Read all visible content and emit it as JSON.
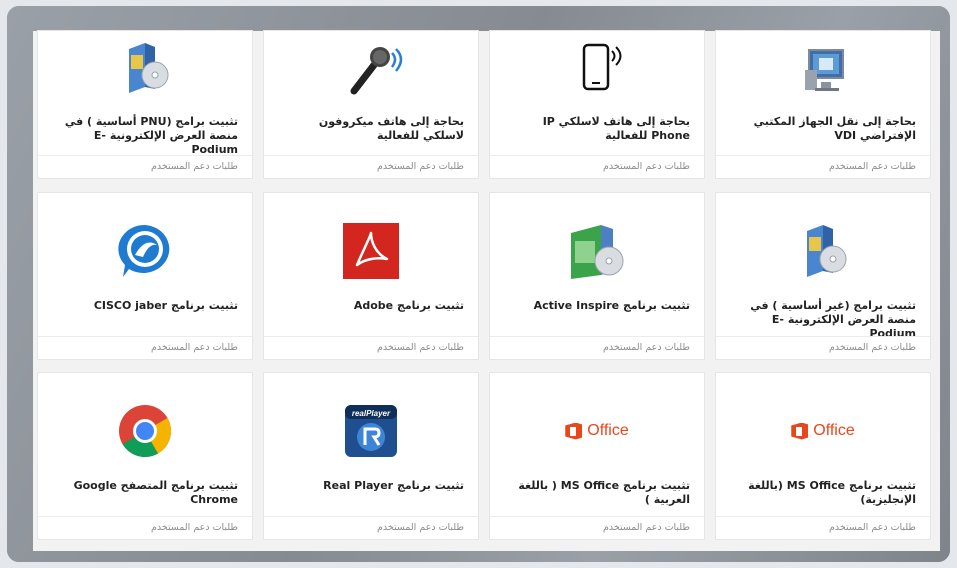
{
  "category_label": "طلبات دعم المستخدم",
  "cards": [
    {
      "title": "بحاجة إلى نقل الجهاز المكتبي الإفتراضي VDI",
      "icon": "virtual-desktop-icon"
    },
    {
      "title": "بحاجة إلى هاتف لاسلكي IP Phone للفعالية",
      "icon": "ip-phone-icon"
    },
    {
      "title": "بحاجة إلى هاتف ميكروفون لاسلكي للفعالية",
      "icon": "microphone-icon"
    },
    {
      "title": "تثبيت برامج (PNU أساسية ) في منصة العرض الإلكترونية E-Podium",
      "icon": "software-install-icon"
    },
    {
      "title": "تثبيت برامج (غير أساسية ) في منصة العرض الإلكترونية E-Podium",
      "icon": "software-install-icon"
    },
    {
      "title": "تثبيت برنامج Active Inspire",
      "icon": "active-inspire-icon"
    },
    {
      "title": "تثبيت برنامج Adobe",
      "icon": "adobe-icon"
    },
    {
      "title": "تثبيت برنامج CISCO jaber",
      "icon": "cisco-jabber-icon"
    },
    {
      "title": "تثبيت برنامج MS Office (باللغة الإنجليزية)",
      "icon": "office-icon"
    },
    {
      "title": "تثبيت برنامج MS Office ( باللغة العربية )",
      "icon": "office-icon"
    },
    {
      "title": "تثبيت برنامج Real Player",
      "icon": "real-player-icon"
    },
    {
      "title": "تثبيت برنامج المتصفح Google Chrome",
      "icon": "chrome-icon"
    }
  ],
  "office_text": "Office",
  "realplayer_text": "realPlayer",
  "colors": {
    "office": "#e8471b",
    "adobe": "#d3261e",
    "panel": "#8d9299"
  }
}
